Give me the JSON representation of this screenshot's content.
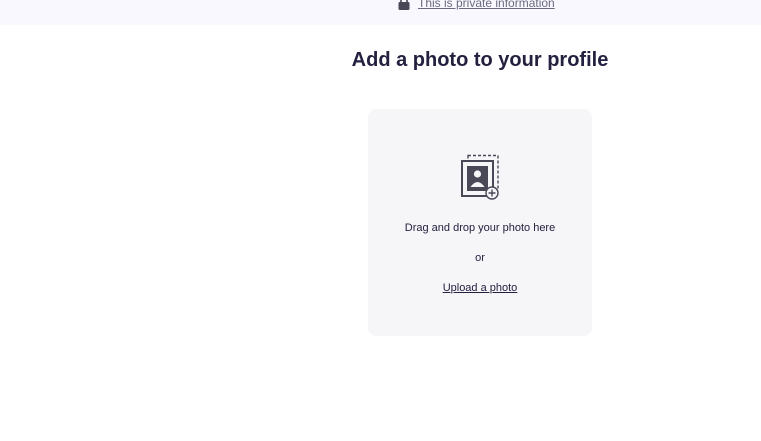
{
  "header": {
    "private_info_label": "This is private information",
    "private_info_icon": "lock-icon"
  },
  "main": {
    "title": "Add a photo to your profile",
    "dropzone": {
      "icon": "add-photo-icon",
      "drag_text": "Drag and drop your photo here",
      "or_text": "or",
      "upload_label": "Upload a photo"
    }
  },
  "colors": {
    "title": "#23213f",
    "banner_bg": "#f8f8fe",
    "dropzone_bg": "#f6f6f9",
    "icon": "#4a4857"
  }
}
